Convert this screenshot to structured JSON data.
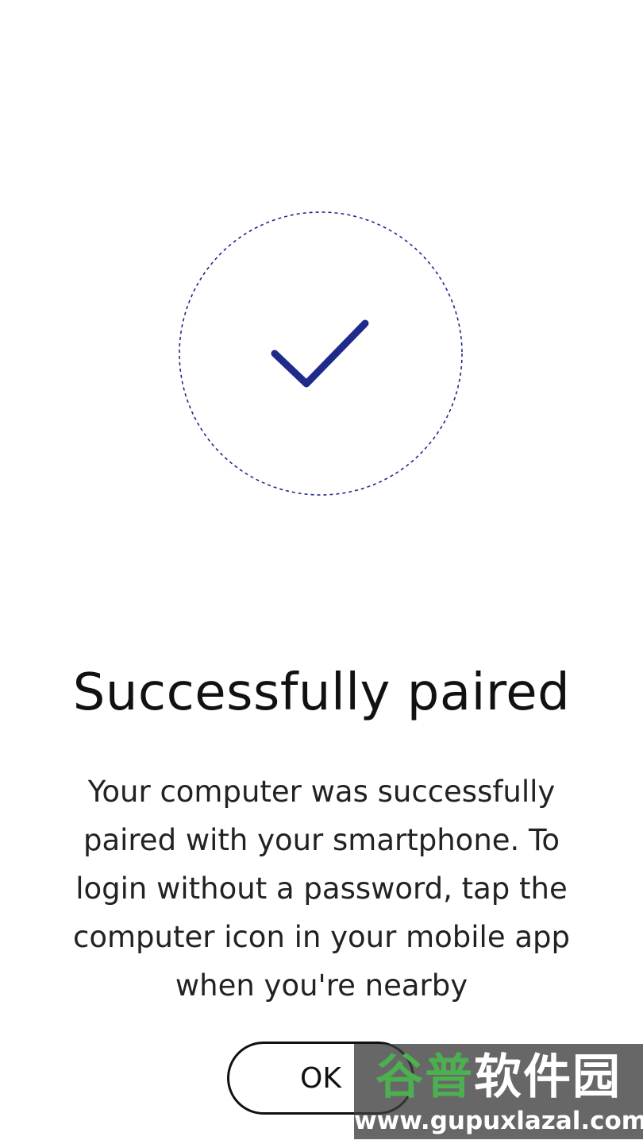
{
  "screen": {
    "icon": "checkmark-icon",
    "title": "Successfully paired",
    "message": "Your computer was successfully paired with your smartphone. To login without a password, tap the computer icon in your mobile app when you're nearby",
    "ok_label": "OK"
  },
  "colors": {
    "accent": "#1f2a8a",
    "background": "#ffffff",
    "text": "#111111"
  },
  "watermark": {
    "logo_part1": "谷普",
    "logo_part2": "软件园",
    "url": "www.gupuxlazal.com"
  }
}
